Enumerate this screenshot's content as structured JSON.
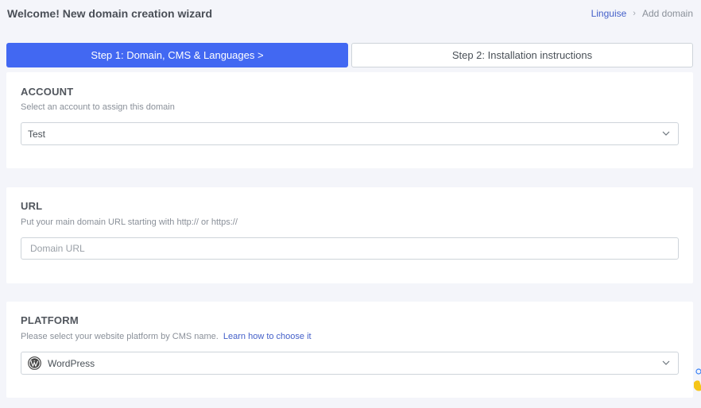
{
  "header": {
    "title": "Welcome! New domain creation wizard",
    "breadcrumb": {
      "home": "Linguise",
      "separator": "›",
      "current": "Add domain"
    }
  },
  "steps": [
    {
      "label": "Step 1: Domain, CMS & Languages  >",
      "active": true
    },
    {
      "label": "Step 2: Installation instructions",
      "active": false
    }
  ],
  "account": {
    "title": "ACCOUNT",
    "description": "Select an account to assign this domain",
    "selected": "Test"
  },
  "url": {
    "title": "URL",
    "description": "Put your main domain URL starting with http:// or https://",
    "placeholder": "Domain URL"
  },
  "platform": {
    "title": "PLATFORM",
    "description": "Please select your website platform by CMS name.",
    "link": "Learn how to choose it",
    "selected": "WordPress",
    "icon": "wordpress-icon"
  },
  "colors": {
    "accent": "#4268f2",
    "link": "#4460c9",
    "background": "#f4f5fa"
  }
}
